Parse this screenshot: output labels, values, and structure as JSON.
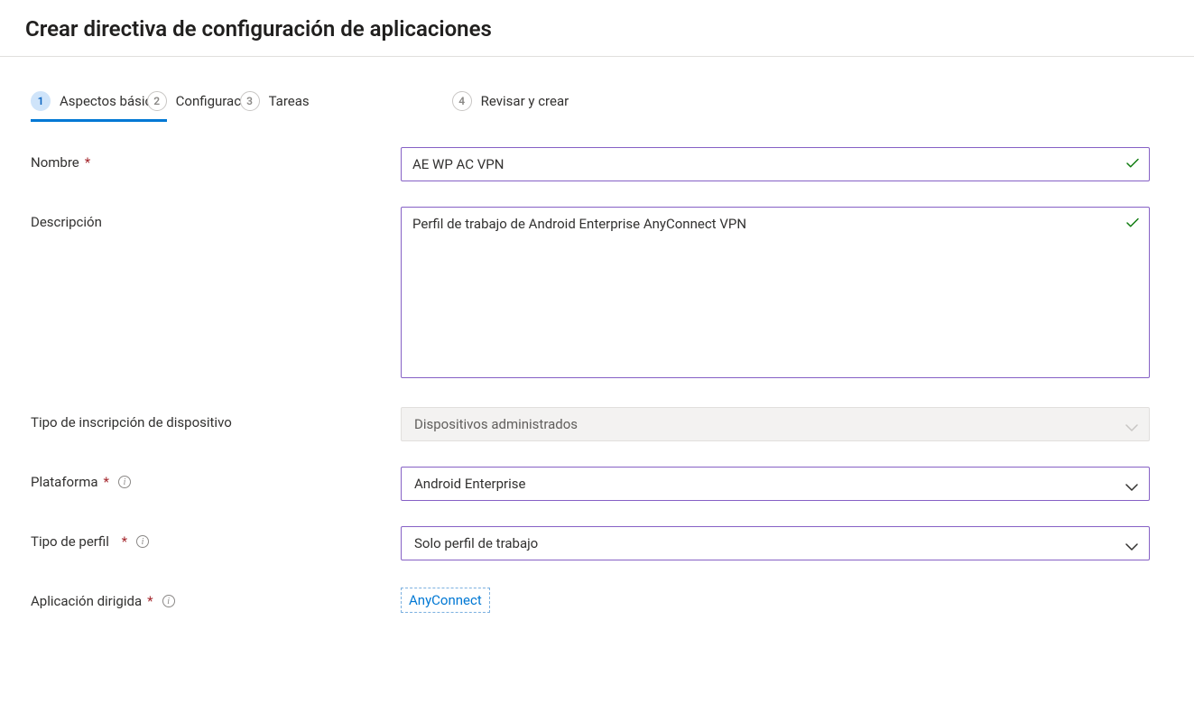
{
  "header": {
    "title": "Crear directiva de configuración de aplicaciones"
  },
  "wizard": {
    "steps": [
      {
        "num": "1",
        "label": "Aspectos básicos"
      },
      {
        "num": "2",
        "label": "Configuración"
      },
      {
        "num": "3",
        "label": "Tareas"
      },
      {
        "num": "4",
        "label": "Revisar y crear"
      }
    ]
  },
  "labels": {
    "name": "Nombre",
    "description": "Descripción",
    "enrollment_type": "Tipo de inscripción de dispositivo",
    "platform": "Plataforma",
    "profile_type": "Tipo de perfil",
    "targeted_app": "Aplicación dirigida"
  },
  "values": {
    "name": "AE WP AC VPN",
    "description": "Perfil de trabajo de Android Enterprise AnyConnect VPN",
    "enrollment_type": "Dispositivos administrados",
    "platform": "Android Enterprise",
    "profile_type": "Solo perfil de trabajo",
    "targeted_app": "AnyConnect"
  }
}
